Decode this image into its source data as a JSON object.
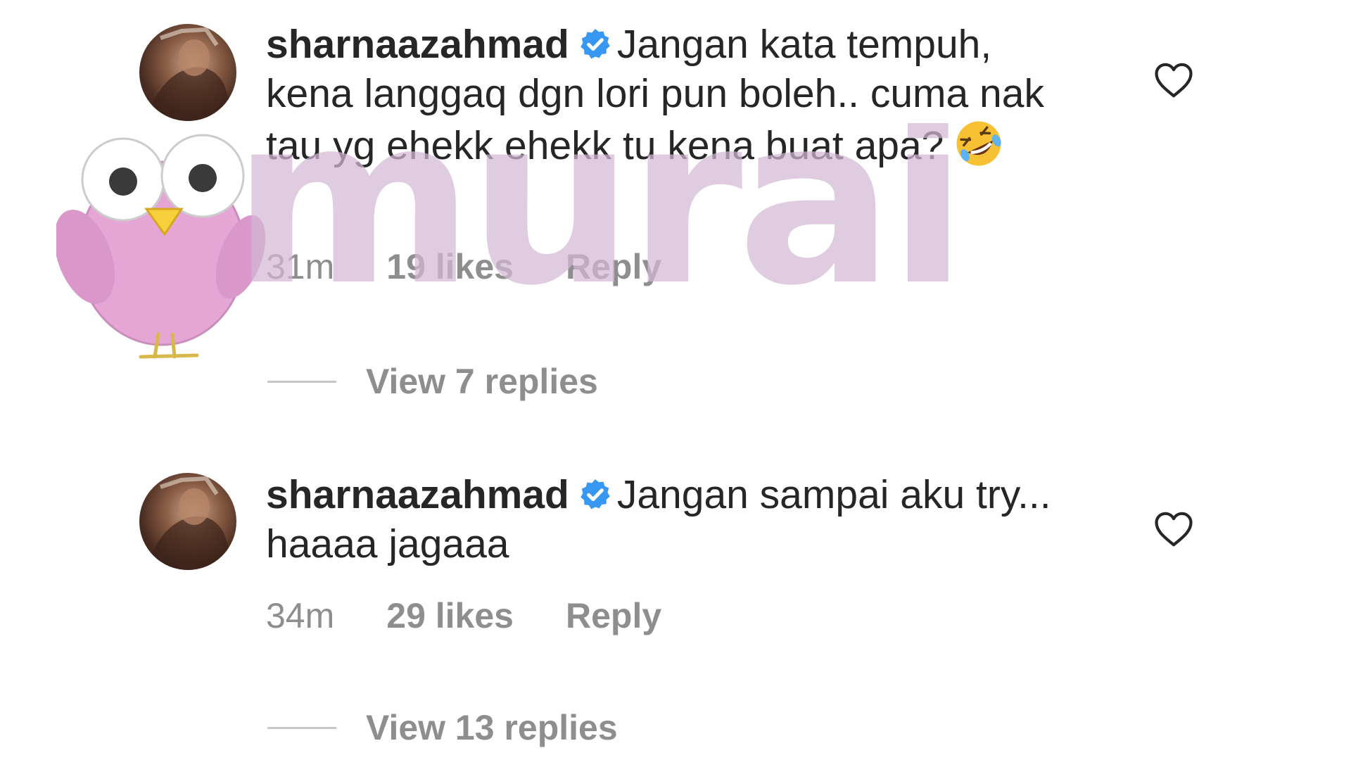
{
  "comments": [
    {
      "username": "sharnaazahmad",
      "text": "Jangan kata tempuh, kena langgaq dgn lori pun boleh.. cuma nak tau yg ehekk ehekk tu kena buat apa?",
      "emoji": "rolling-on-floor-laughing",
      "time": "31m",
      "likes": "19 likes",
      "reply_label": "Reply",
      "view_replies": "View 7 replies"
    },
    {
      "username": "sharnaazahmad",
      "text": "Jangan sampai aku try... haaaa jagaaa",
      "time": "34m",
      "likes": "29 likes",
      "reply_label": "Reply",
      "view_replies": "View 13 replies"
    }
  ],
  "watermark": {
    "text": "murai"
  },
  "colors": {
    "text": "#262626",
    "meta": "#8e8e8e",
    "verified": "#3897f0",
    "watermark": "#d3b8d6",
    "bird": "#e5a6d6"
  },
  "icons": {
    "verified": "verified-badge-icon",
    "like": "heart-icon",
    "emoji": "laughing-emoji-icon",
    "watermark_logo": "bird-logo-icon"
  }
}
